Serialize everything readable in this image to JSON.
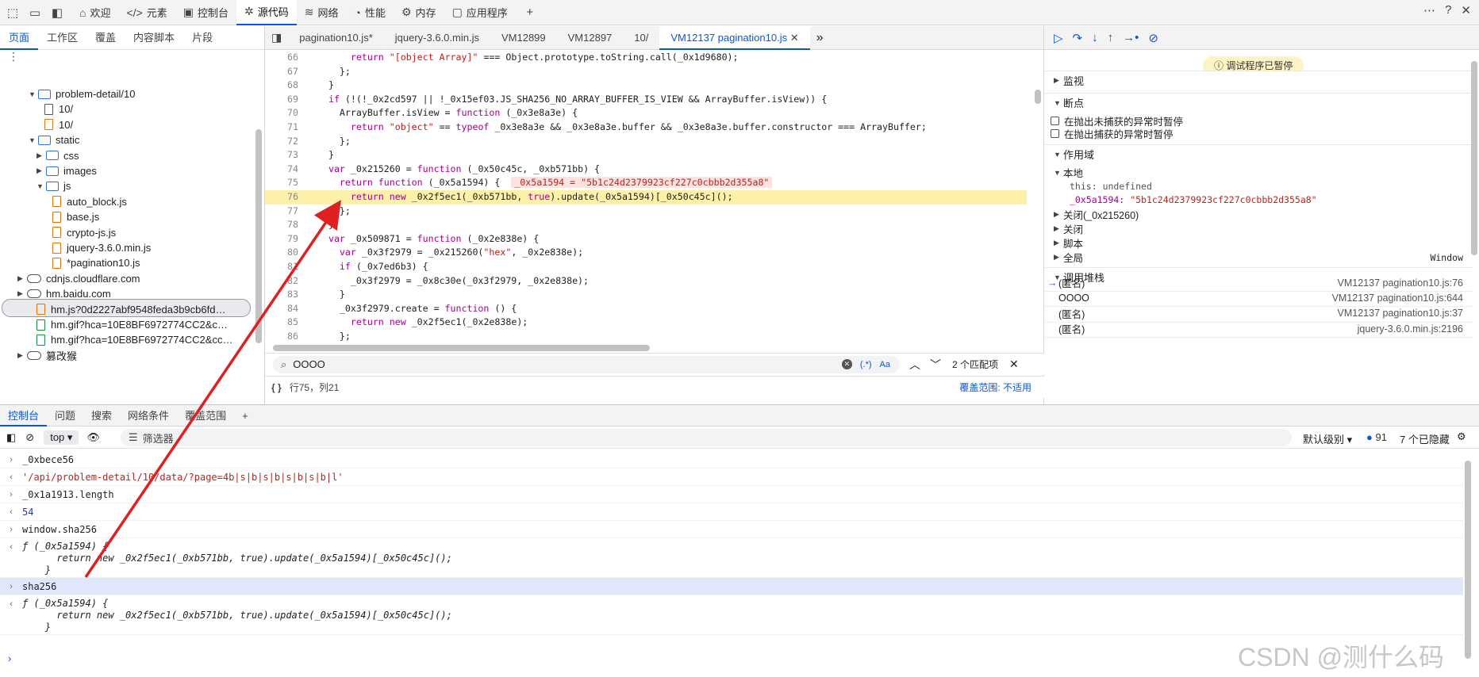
{
  "toolbar": {
    "tabs": [
      {
        "label": "欢迎",
        "icon": "home-icon"
      },
      {
        "label": "元素",
        "icon": "code-icon"
      },
      {
        "label": "控制台",
        "icon": "console-icon"
      },
      {
        "label": "源代码",
        "icon": "bug-icon"
      },
      {
        "label": "网络",
        "icon": "wifi-icon"
      },
      {
        "label": "性能",
        "icon": "gauge-icon"
      },
      {
        "label": "内存",
        "icon": "gear-icon"
      },
      {
        "label": "应用程序",
        "icon": "window-icon"
      }
    ],
    "active_tab": "源代码"
  },
  "navigator": {
    "tabs": [
      "页面",
      "工作区",
      "覆盖",
      "内容脚本",
      "片段"
    ],
    "active_tab": "页面",
    "tree": [
      {
        "label": "problem-detail/10",
        "type": "folder",
        "expanded": true
      },
      {
        "label": "10/",
        "type": "file"
      },
      {
        "label": "10/",
        "type": "file-orange"
      },
      {
        "label": "static",
        "type": "folder",
        "expanded": true
      },
      {
        "label": "css",
        "type": "folder",
        "expanded": false
      },
      {
        "label": "images",
        "type": "folder",
        "expanded": false
      },
      {
        "label": "js",
        "type": "folder",
        "expanded": true
      },
      {
        "label": "auto_block.js",
        "type": "file-orange"
      },
      {
        "label": "base.js",
        "type": "file-orange"
      },
      {
        "label": "crypto-js.js",
        "type": "file-orange"
      },
      {
        "label": "jquery-3.6.0.min.js",
        "type": "file-orange"
      },
      {
        "label": "*pagination10.js",
        "type": "file-orange",
        "selected": true
      },
      {
        "label": "cdnjs.cloudflare.com",
        "type": "domain"
      },
      {
        "label": "hm.baidu.com",
        "type": "domain"
      },
      {
        "label": "hm.js?0d2227abf9548feda3b9cb6fd…",
        "type": "file-orange"
      },
      {
        "label": "hm.gif?hca=10E8BF6972774CC2&c…",
        "type": "file-green"
      },
      {
        "label": "hm.gif?hca=10E8BF6972774CC2&cc…",
        "type": "file-green"
      },
      {
        "label": "篡改猴",
        "type": "domain"
      }
    ]
  },
  "editor": {
    "tabs": [
      "pagination10.js*",
      "jquery-3.6.0.min.js",
      "VM12899",
      "VM12897",
      "10/",
      "VM12137 pagination10.js"
    ],
    "active_tab": "VM12137 pagination10.js",
    "lines": [
      {
        "n": "66",
        "html": "      <span class=\"kw\">return</span> <span class=\"str\">\"[object Array]\"</span> === Object.prototype.toString.call(_0x1d9680);"
      },
      {
        "n": "67",
        "html": "    };"
      },
      {
        "n": "68",
        "html": "  }"
      },
      {
        "n": "69",
        "html": "  <span class=\"kw\">if</span> (!(!_0x2cd597 || !_0x15ef03.JS_SHA256_NO_ARRAY_BUFFER_IS_VIEW &amp;&amp; ArrayBuffer.isView)) {"
      },
      {
        "n": "70",
        "html": "    ArrayBuffer.isView = <span class=\"kw\">function</span> (_0x3e8a3e) {"
      },
      {
        "n": "71",
        "html": "      <span class=\"kw\">return</span> <span class=\"str\">\"object\"</span> == <span class=\"kw\">typeof</span> _0x3e8a3e &amp;&amp; _0x3e8a3e.buffer &amp;&amp; _0x3e8a3e.buffer.constructor === ArrayBuffer;"
      },
      {
        "n": "72",
        "html": "    };"
      },
      {
        "n": "73",
        "html": "  }"
      },
      {
        "n": "74",
        "html": "  <span class=\"kw\">var</span> _0x215260 = <span class=\"kw\">function</span> (_0x50c45c, _0xb571bb) {"
      },
      {
        "n": "75",
        "html": "    <span class=\"kw\">return</span> <span class=\"kw\">function</span> (_0x5a1594) {  <span class=\"inline-val\">_0x5a1594 = \"5b1c24d2379923cf227c0cbbb2d355a8\"</span>"
      },
      {
        "n": "76",
        "html": "      <span class=\"kw\">return</span> <span class=\"kw\">new</span> _0x2f5ec1(_0xb571bb, <span class=\"kw\">true</span>).update(_0x5a1594)[_0x50c45c]();",
        "exec": true
      },
      {
        "n": "77",
        "html": "    };"
      },
      {
        "n": "78",
        "html": "  };"
      },
      {
        "n": "79",
        "html": "  <span class=\"kw\">var</span> _0x509871 = <span class=\"kw\">function</span> (_0x2e838e) {"
      },
      {
        "n": "80",
        "html": "    <span class=\"kw\">var</span> _0x3f2979 = _0x215260(<span class=\"str\">\"hex\"</span>, _0x2e838e);"
      },
      {
        "n": "81",
        "html": "    <span class=\"kw\">if</span> (_0x7ed6b3) {"
      },
      {
        "n": "82",
        "html": "      _0x3f2979 = _0x8c30e(_0x3f2979, _0x2e838e);"
      },
      {
        "n": "83",
        "html": "    }"
      },
      {
        "n": "84",
        "html": "    _0x3f2979.create = <span class=\"kw\">function</span> () {"
      },
      {
        "n": "85",
        "html": "      <span class=\"kw\">return</span> <span class=\"kw\">new</span> _0x2f5ec1(_0x2e838e);"
      },
      {
        "n": "86",
        "html": "    };"
      }
    ],
    "search": {
      "query": "OOOO",
      "case_label": "Aa",
      "regex_label": "(.*)",
      "matches": "2 个匹配项"
    },
    "status": {
      "position": "行75，列21",
      "coverage": "覆盖范围: 不适用",
      "braces": "{ }"
    }
  },
  "debugger": {
    "paused": "调试程序已暂停",
    "sections": {
      "watch": "监视",
      "breakpoints": "断点",
      "pause_uncaught": "在抛出未捕获的异常时暂停",
      "pause_caught": "在抛出捕获的异常时暂停",
      "scope": "作用域",
      "local": "本地",
      "this_key": "this:",
      "this_val": "undefined",
      "var_key": "_0x5a1594:",
      "var_val": "\"5b1c24d2379923cf227c0cbbb2d355a8\"",
      "closure1": "关闭(_0x215260)",
      "closure2": "关闭",
      "script": "脚本",
      "global": "全局",
      "global_val": "Window",
      "callstack": "调用堆栈"
    },
    "stack": [
      {
        "name": "(匿名)",
        "loc": "VM12137 pagination10.js:76",
        "current": true
      },
      {
        "name": "OOOO",
        "loc": "VM12137 pagination10.js:644"
      },
      {
        "name": "(匿名)",
        "loc": "VM12137 pagination10.js:37"
      },
      {
        "name": "(匿名)",
        "loc": "jquery-3.6.0.min.js:2196"
      }
    ]
  },
  "drawer": {
    "tabs": [
      "控制台",
      "问题",
      "搜索",
      "网络条件",
      "覆盖范围"
    ],
    "active_tab": "控制台",
    "context": "top",
    "filter_placeholder": "筛选器",
    "level": "默认级别",
    "message_count": "91",
    "hidden": "7 个已隐藏"
  },
  "console": [
    {
      "dir": ">",
      "text": "_0xbece56",
      "cls": ""
    },
    {
      "dir": "<",
      "text": "'/api/problem-detail/10/data/?page=4b|s|b|s|b|s|b|s|b|l'",
      "cls": "res-str"
    },
    {
      "dir": ">",
      "text": "_0x1a1913.length",
      "cls": ""
    },
    {
      "dir": "<",
      "text": "54",
      "cls": "res-num"
    },
    {
      "dir": ">",
      "text": "window.sha256",
      "cls": ""
    },
    {
      "dir": "<",
      "text": "ƒ (_0x5a1594) {\n      return new _0x2f5ec1(_0xb571bb, true).update(_0x5a1594)[_0x50c45c]();\n    }",
      "cls": "res-italic"
    },
    {
      "dir": ">",
      "text": "sha256",
      "cls": "",
      "hl": true
    },
    {
      "dir": "<",
      "text": "ƒ (_0x5a1594) {\n      return new _0x2f5ec1(_0xb571bb, true).update(_0x5a1594)[_0x50c45c]();\n    }",
      "cls": "res-italic"
    }
  ],
  "watermark": "CSDN @测什么码",
  "colors": {
    "accent": "#0b57d0",
    "arrow": "#e02020",
    "exec_line": "#fcf1a6"
  }
}
